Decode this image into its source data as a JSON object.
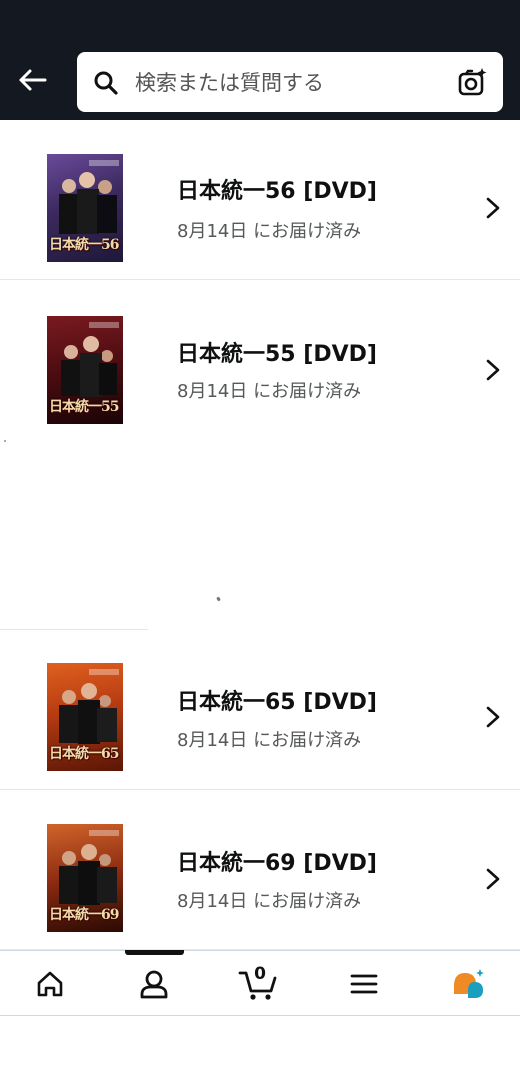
{
  "header": {
    "back_icon": "arrow-left-icon",
    "search": {
      "placeholder": "検索または質問する",
      "value": "",
      "search_icon": "magnifier-icon",
      "camera_icon": "camera-sparkle-icon"
    }
  },
  "orders": [
    {
      "title": "日本統一56 [DVD]",
      "status": "8月14日 にお届け済み",
      "cover_logo": "日本統一56",
      "cover_color": "#3b2a5e"
    },
    {
      "title": "日本統一55 [DVD]",
      "status": "8月14日 にお届け済み",
      "cover_logo": "日本統一55",
      "cover_color": "#5a1216"
    },
    {
      "title": "日本統一65 [DVD]",
      "status": "8月14日 にお届け済み",
      "cover_logo": "日本統一65",
      "cover_color": "#b53a12"
    },
    {
      "title": "日本統一69 [DVD]",
      "status": "8月14日 にお届け済み",
      "cover_logo": "日本統一69",
      "cover_color": "#8a2a10"
    }
  ],
  "bottom_nav": {
    "items": [
      "home-icon",
      "account-icon",
      "cart-icon",
      "menu-icon",
      "rufus-assistant-icon"
    ],
    "active_index": 1,
    "cart_count": "0"
  },
  "colors": {
    "header_bg": "#141921",
    "assistant_orange": "#f08a24",
    "assistant_teal": "#1a9fbf"
  }
}
